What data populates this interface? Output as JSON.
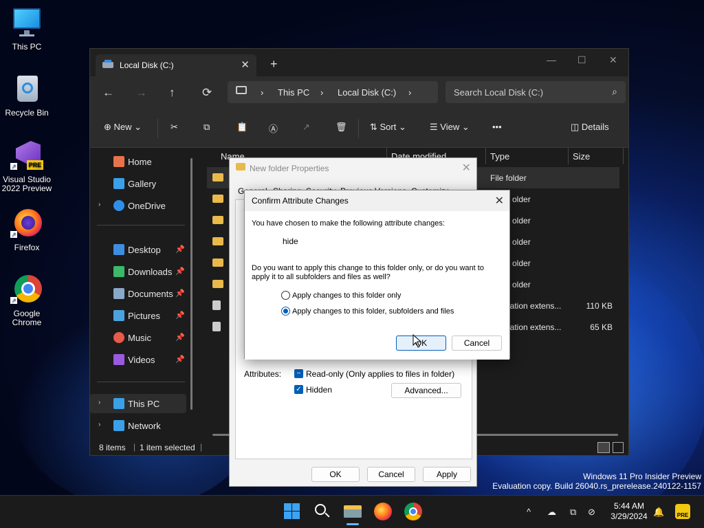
{
  "desktop": {
    "icons": [
      {
        "label": "This PC"
      },
      {
        "label": "Recycle Bin"
      },
      {
        "label": "Visual Studio 2022 Preview",
        "badge": "PRE"
      },
      {
        "label": "Firefox"
      },
      {
        "label": "Google Chrome"
      }
    ]
  },
  "explorer": {
    "tab_title": "Local Disk (C:)",
    "tab_close": "✕",
    "new_tab": "+",
    "win_minimize": "—",
    "win_maximize": "☐",
    "win_close": "✕",
    "nav": {
      "back": "←",
      "forward": "→",
      "up": "↑",
      "refresh": "⟳"
    },
    "breadcrumb": [
      "This PC",
      "Local Disk (C:)"
    ],
    "breadcrumb_sep": "›",
    "search_placeholder": "Search Local Disk (C:)",
    "toolbar": {
      "new_label": "New",
      "sort_label": "Sort",
      "view_label": "View",
      "more_label": "•••",
      "details_label": "Details"
    },
    "sidebar": {
      "items": [
        {
          "label": "Home",
          "icon": "home-icon",
          "color": "#e8734a"
        },
        {
          "label": "Gallery",
          "icon": "gallery-icon",
          "color": "#3aa0e8"
        },
        {
          "label": "OneDrive",
          "icon": "cloud-icon",
          "color": "#2f8fe8"
        },
        {
          "label": "Desktop",
          "icon": "desktop-icon",
          "color": "#3d8ee0"
        },
        {
          "label": "Downloads",
          "icon": "download-icon",
          "color": "#3bb86a"
        },
        {
          "label": "Documents",
          "icon": "document-icon",
          "color": "#8aa8c8"
        },
        {
          "label": "Pictures",
          "icon": "pictures-icon",
          "color": "#4aa3e0"
        },
        {
          "label": "Music",
          "icon": "music-icon",
          "color": "#e85a4a"
        },
        {
          "label": "Videos",
          "icon": "videos-icon",
          "color": "#9a5ae0"
        },
        {
          "label": "This PC",
          "icon": "computer-icon",
          "color": "#3aa0e8"
        },
        {
          "label": "Network",
          "icon": "network-icon",
          "color": "#3aa0e8"
        }
      ]
    },
    "columns": [
      "Name",
      "Date modified",
      "Type",
      "Size"
    ],
    "rows": [
      {
        "type": "File folder",
        "size": ""
      },
      {
        "type": "older",
        "size": ""
      },
      {
        "type": "older",
        "size": ""
      },
      {
        "type": "older",
        "size": ""
      },
      {
        "type": "older",
        "size": ""
      },
      {
        "type": "older",
        "size": ""
      },
      {
        "type": "ication extens...",
        "size": "110 KB"
      },
      {
        "type": "ication extens...",
        "size": "65 KB"
      }
    ],
    "status": {
      "count": "8 items",
      "selected": "1 item selected"
    }
  },
  "properties": {
    "title": "New folder Properties",
    "tabs": [
      "General",
      "Sharing",
      "Security",
      "Previous Versions",
      "Customize"
    ],
    "attributes_label": "Attributes:",
    "readonly_label": "Read-only (Only applies to files in folder)",
    "hidden_label": "Hidden",
    "advanced_button": "Advanced...",
    "ok": "OK",
    "cancel": "Cancel",
    "apply": "Apply"
  },
  "confirm": {
    "title": "Confirm Attribute Changes",
    "intro": "You have chosen to make the following attribute changes:",
    "change": "hide",
    "question_line1": "Do you want to apply this change to this folder only, or do you want to",
    "question_line2": "apply it to all subfolders and files as well?",
    "option1": "Apply changes to this folder only",
    "option2": "Apply changes to this folder, subfolders and files",
    "selected_option": 2,
    "ok": "OK",
    "cancel": "Cancel"
  },
  "watermark": {
    "line1": "Windows 11 Pro Insider Preview",
    "line2": "Evaluation copy. Build 26040.rs_prerelease.240122-1157"
  },
  "taskbar": {
    "time": "5:44 AM",
    "date": "3/29/2024",
    "tray_chevron": "^"
  },
  "colors": {
    "accent": "#005fb8",
    "folder": "#e9b94c"
  }
}
